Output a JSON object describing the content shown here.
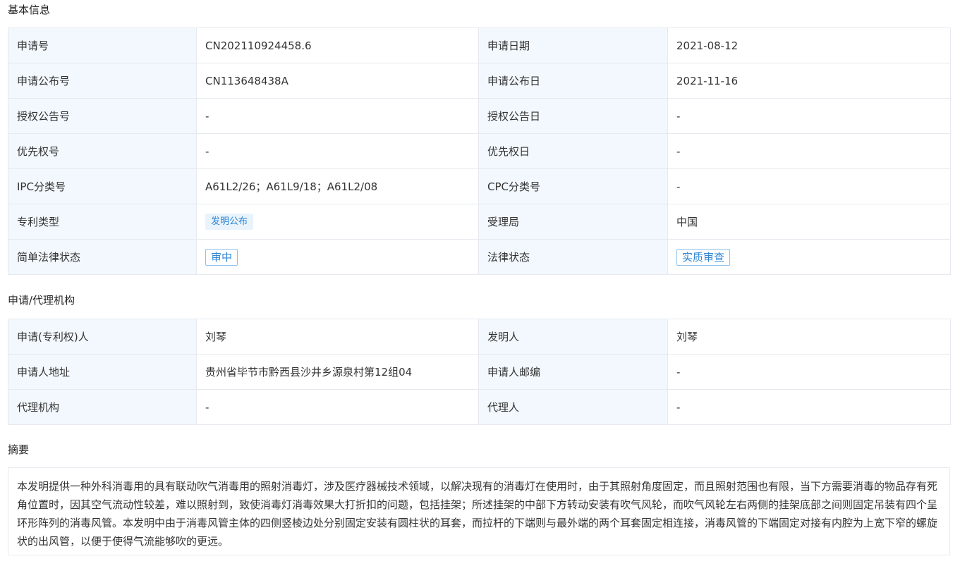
{
  "sections": {
    "basic": "基本信息",
    "agency": "申请/代理机构",
    "abstract": "摘要"
  },
  "basic": {
    "app_no_label": "申请号",
    "app_no": "CN202110924458.6",
    "app_date_label": "申请日期",
    "app_date": "2021-08-12",
    "pub_no_label": "申请公布号",
    "pub_no": "CN113648438A",
    "pub_date_label": "申请公布日",
    "pub_date": "2021-11-16",
    "grant_no_label": "授权公告号",
    "grant_no": "-",
    "grant_date_label": "授权公告日",
    "grant_date": "-",
    "priority_no_label": "优先权号",
    "priority_no": "-",
    "priority_date_label": "优先权日",
    "priority_date": "-",
    "ipc_label": "IPC分类号",
    "ipc": "A61L2/26；A61L9/18；A61L2/08",
    "cpc_label": "CPC分类号",
    "cpc": "-",
    "patent_type_label": "专利类型",
    "patent_type": "发明公布",
    "office_label": "受理局",
    "office": "中国",
    "simple_legal_label": "简单法律状态",
    "simple_legal": "审中",
    "legal_label": "法律状态",
    "legal": "实质审查"
  },
  "agency": {
    "applicant_label": "申请(专利权)人",
    "applicant": "刘琴",
    "inventor_label": "发明人",
    "inventor": "刘琴",
    "address_label": "申请人地址",
    "address": "贵州省毕节市黔西县沙井乡源泉村第12组04",
    "postcode_label": "申请人邮编",
    "postcode": "-",
    "agency_label": "代理机构",
    "agency": "-",
    "agent_label": "代理人",
    "agent": "-"
  },
  "abstract": {
    "text": "本发明提供一种外科消毒用的具有联动吹气消毒用的照射消毒灯，涉及医疗器械技术领域，以解决现有的消毒灯在使用时，由于其照射角度固定，而且照射范围也有限，当下方需要消毒的物品存有死角位置时，因其空气流动性较差，难以照射到，致使消毒灯消毒效果大打折扣的问题，包括挂架；所述挂架的中部下方转动安装有吹气风轮，而吹气风轮左右两侧的挂架底部之间则固定吊装有四个呈环形阵列的消毒风管。本发明中由于消毒风管主体的四侧竖棱边处分别固定安装有圆柱状的耳套，而拉杆的下端则与最外端的两个耳套固定相连接，消毒风管的下端固定对接有内腔为上宽下窄的螺旋状的出风管，以便于使得气流能够吹的更远。"
  }
}
